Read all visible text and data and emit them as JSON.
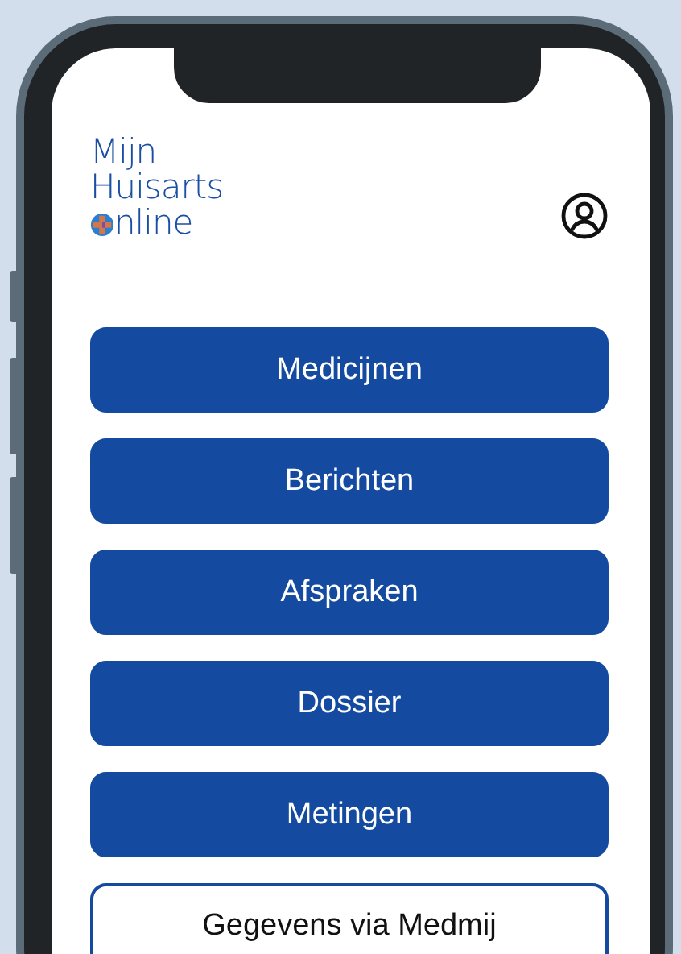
{
  "logo": {
    "lines": [
      "Mijn",
      "Huisarts",
      "nline"
    ]
  },
  "menu": [
    {
      "label": "Medicijnen",
      "kind": "filled"
    },
    {
      "label": "Berichten",
      "kind": "filled"
    },
    {
      "label": "Afspraken",
      "kind": "filled"
    },
    {
      "label": "Dossier",
      "kind": "filled"
    },
    {
      "label": "Metingen",
      "kind": "filled"
    },
    {
      "label": "Gegevens via Medmij",
      "kind": "outline"
    }
  ]
}
